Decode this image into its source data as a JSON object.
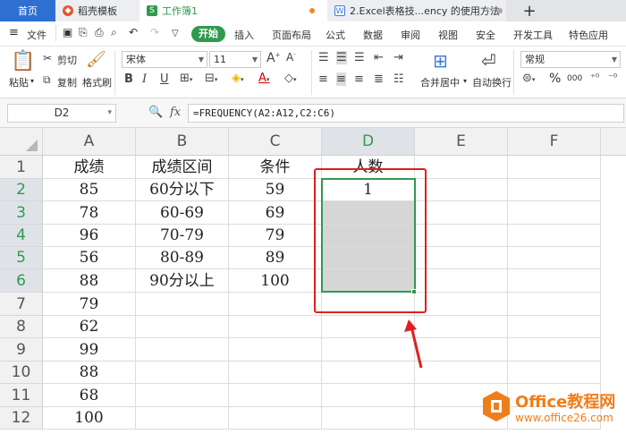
{
  "tabs": {
    "home": "首页",
    "daoke": "稻壳模板",
    "workbook": "工作簿1",
    "doc": "2.Excel表格技...ency 的使用方法",
    "add": "+"
  },
  "menu": {
    "file": "文件",
    "start": "开始",
    "items": [
      "插入",
      "页面布局",
      "公式",
      "数据",
      "审阅",
      "视图",
      "安全",
      "开发工具",
      "特色应用"
    ]
  },
  "ribbon": {
    "paste": "粘贴",
    "cut": "剪切",
    "copy": "复制",
    "format_painter": "格式刷",
    "font_name": "宋体",
    "font_size": "11",
    "merge_center": "合并居中",
    "wrap_text": "自动换行",
    "number_format": "常规",
    "percent": "%",
    "thousands": "000"
  },
  "formula_bar": {
    "name_box": "D2",
    "fx": "fx",
    "formula": "=FREQUENCY(A2:A12,C2:C6)"
  },
  "columns": [
    "A",
    "B",
    "C",
    "D",
    "E",
    "F"
  ],
  "rows": [
    {
      "n": "1",
      "a": "成绩",
      "b": "成绩区间",
      "c": "条件",
      "d": "人数"
    },
    {
      "n": "2",
      "a": "85",
      "b": "60分以下",
      "c": "59",
      "d": "1"
    },
    {
      "n": "3",
      "a": "78",
      "b": "60-69",
      "c": "69",
      "d": ""
    },
    {
      "n": "4",
      "a": "96",
      "b": "70-79",
      "c": "79",
      "d": ""
    },
    {
      "n": "5",
      "a": "56",
      "b": "80-89",
      "c": "89",
      "d": ""
    },
    {
      "n": "6",
      "a": "88",
      "b": "90分以上",
      "c": "100",
      "d": ""
    },
    {
      "n": "7",
      "a": "79",
      "b": "",
      "c": "",
      "d": ""
    },
    {
      "n": "8",
      "a": "62",
      "b": "",
      "c": "",
      "d": ""
    },
    {
      "n": "9",
      "a": "99",
      "b": "",
      "c": "",
      "d": ""
    },
    {
      "n": "10",
      "a": "88",
      "b": "",
      "c": "",
      "d": ""
    },
    {
      "n": "11",
      "a": "68",
      "b": "",
      "c": "",
      "d": ""
    },
    {
      "n": "12",
      "a": "100",
      "b": "",
      "c": "",
      "d": ""
    }
  ],
  "watermark": {
    "brand": "Office教程网",
    "url": "www.office26.com"
  },
  "colors": {
    "accent_green": "#2f9a4e",
    "annotation_red": "#e02020",
    "watermark_orange": "#f07d1a"
  }
}
